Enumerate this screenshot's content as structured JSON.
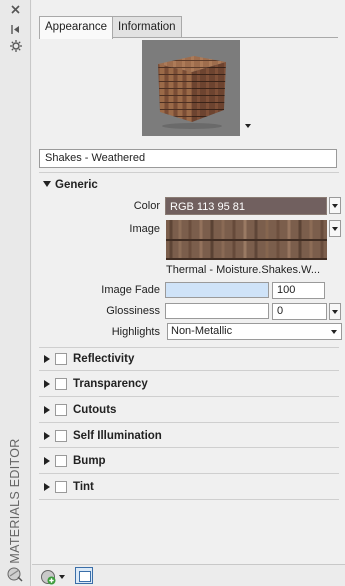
{
  "palette": {
    "accent": "#3a6ea8",
    "color_swatch": "#71605f",
    "fade_fill": "#cfe3f8"
  },
  "strip": {
    "title": "MATERIALS EDITOR",
    "icons": [
      "close-icon",
      "auto-hide-icon",
      "properties-icon"
    ],
    "bottom_icon": "material-ball-icon"
  },
  "tabs": [
    {
      "label": "Appearance",
      "active": true
    },
    {
      "label": "Information",
      "active": false
    }
  ],
  "material_name": "Shakes - Weathered",
  "generic": {
    "heading": "Generic",
    "color_label": "Color",
    "color_value": "RGB 113 95 81",
    "image_label": "Image",
    "image_caption": "Thermal - Moisture.Shakes.W...",
    "image_fade_label": "Image Fade",
    "image_fade_value": "100",
    "image_fade_fraction": 0.64,
    "glossiness_label": "Glossiness",
    "glossiness_value": "0",
    "highlights_label": "Highlights",
    "highlights_value": "Non-Metallic"
  },
  "sections": [
    {
      "label": "Reflectivity",
      "checked": false
    },
    {
      "label": "Transparency",
      "checked": false
    },
    {
      "label": "Cutouts",
      "checked": false
    },
    {
      "label": "Self Illumination",
      "checked": false
    },
    {
      "label": "Bump",
      "checked": false
    },
    {
      "label": "Tint",
      "checked": false
    }
  ],
  "footer": {
    "icons": [
      "create-material-icon",
      "material-browser-icon"
    ]
  }
}
